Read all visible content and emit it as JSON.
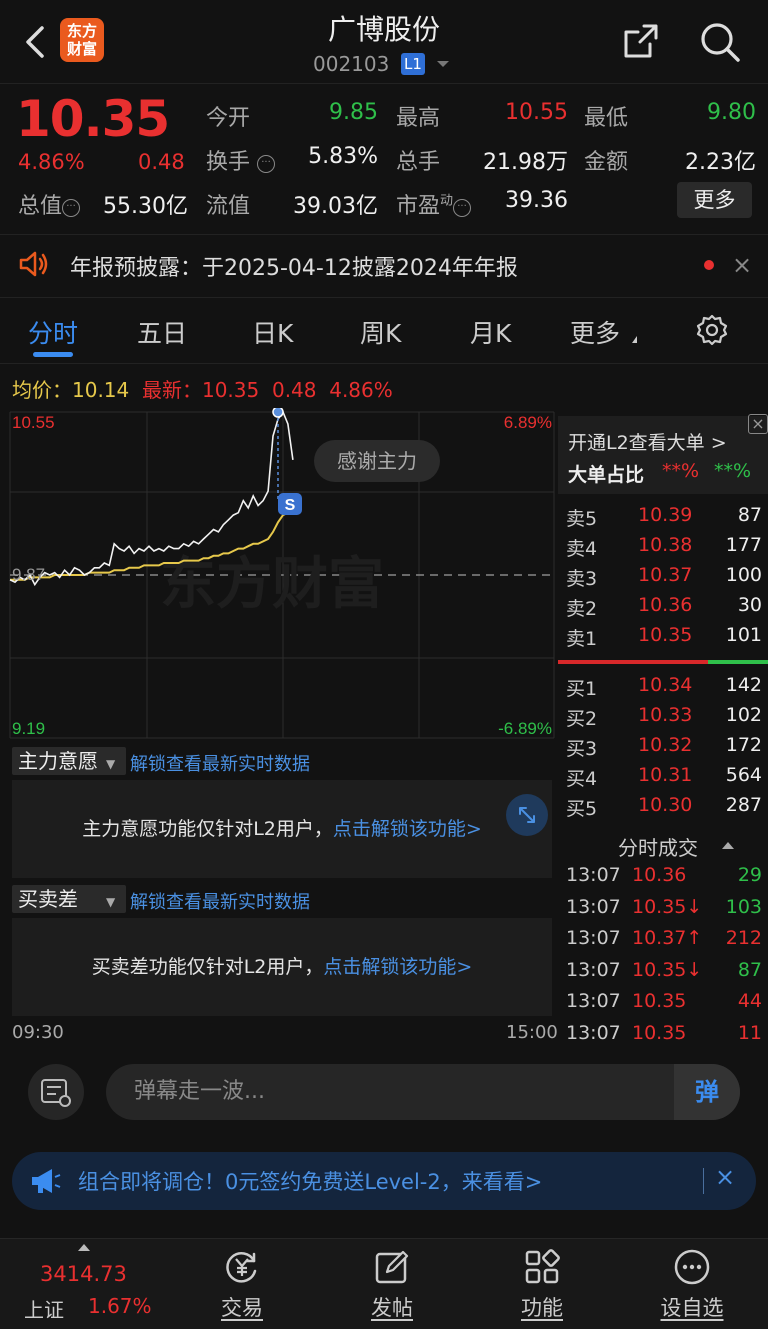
{
  "header": {
    "logo_line1": "东方",
    "logo_line2": "财富",
    "stock_name": "广博股份",
    "stock_code": "002103",
    "level_badge": "L1"
  },
  "quote": {
    "price": "10.35",
    "change_pct": "4.86%",
    "change": "0.48",
    "fields": {
      "open_label": "今开",
      "open": "9.85",
      "high_label": "最高",
      "high": "10.55",
      "low_label": "最低",
      "low": "9.80",
      "turnover_label": "换手",
      "turnover": "5.83%",
      "volume_label": "总手",
      "volume": "21.98万",
      "amount_label": "金额",
      "amount": "2.23亿",
      "mktcap_label": "总值",
      "mktcap": "55.30亿",
      "float_label": "流值",
      "float": "39.03亿",
      "pe_label": "市盈",
      "pe_sup": "动",
      "pe": "39.36"
    },
    "more_button": "更多"
  },
  "notice": {
    "text": "年报预披露：于2025-04-12披露2024年年报",
    "close": "×"
  },
  "tabs": [
    "分时",
    "五日",
    "日K",
    "周K",
    "月K",
    "更多"
  ],
  "avg_line": {
    "avg_label": "均价：",
    "avg_value": "10.14",
    "latest_label": "最新：",
    "latest_value": "10.35",
    "latest_change": "0.48",
    "latest_pct": "4.86%"
  },
  "chart_data": {
    "type": "line",
    "y_top_label": "10.55",
    "y_bottom_label": "9.19",
    "pct_top_label": "6.89%",
    "pct_bottom_label": "-6.89%",
    "prev_close_label": "9.87",
    "ylim": [
      9.19,
      10.55
    ],
    "prev_close": 9.87,
    "x_start_label": "09:30",
    "x_end_label": "15:00",
    "tooltip": "感谢主力",
    "signal_badge": "S",
    "series": [
      {
        "name": "价格",
        "values": [
          9.85,
          9.84,
          9.86,
          9.85,
          9.87,
          9.83,
          9.86,
          9.88,
          9.87,
          9.88,
          9.86,
          9.89,
          9.87,
          9.9,
          9.89,
          9.87,
          9.88,
          9.9,
          9.9,
          9.92,
          9.91,
          10.0,
          9.98,
          9.97,
          9.99,
          9.96,
          9.98,
          9.97,
          9.99,
          9.97,
          9.98,
          9.97,
          9.99,
          9.98,
          9.98,
          10.0,
          9.99,
          10.01,
          10.0,
          10.02,
          10.04,
          10.06,
          10.05,
          10.08,
          10.1,
          10.12,
          10.13,
          10.18,
          10.15,
          10.2,
          10.16,
          10.18,
          10.22,
          10.45,
          10.52,
          10.55,
          10.5,
          10.35
        ],
        "color": "#ffffff"
      },
      {
        "name": "均价",
        "values": [
          9.85,
          9.85,
          9.85,
          9.85,
          9.86,
          9.86,
          9.86,
          9.86,
          9.86,
          9.87,
          9.87,
          9.87,
          9.87,
          9.87,
          9.87,
          9.87,
          9.88,
          9.88,
          9.88,
          9.88,
          9.88,
          9.89,
          9.89,
          9.89,
          9.9,
          9.9,
          9.9,
          9.91,
          9.91,
          9.91,
          9.91,
          9.92,
          9.92,
          9.92,
          9.92,
          9.93,
          9.93,
          9.93,
          9.93,
          9.94,
          9.94,
          9.95,
          9.95,
          9.96,
          9.96,
          9.97,
          9.98,
          9.98,
          9.99,
          10.0,
          10.0,
          10.01,
          10.02,
          10.05,
          10.09,
          10.12,
          10.13,
          10.14
        ],
        "color": "#e6c84b"
      }
    ],
    "grid": true
  },
  "panels": {
    "main_intent_label": "主力意愿",
    "unlock_link": "解锁查看最新实时数据",
    "main_intent_text": "主力意愿功能仅针对L2用户，",
    "unlock_action": "点击解锁该功能>",
    "spread_label": "买卖差",
    "spread_text": "买卖差功能仅针对L2用户，"
  },
  "order_book": {
    "banner_text": "开通L2查看大单 >",
    "big_order_label": "大单占比",
    "big_order_red": "**%",
    "big_order_green": "**%",
    "asks": [
      {
        "label": "卖5",
        "price": "10.39",
        "vol": "87"
      },
      {
        "label": "卖4",
        "price": "10.38",
        "vol": "177"
      },
      {
        "label": "卖3",
        "price": "10.37",
        "vol": "100"
      },
      {
        "label": "卖2",
        "price": "10.36",
        "vol": "30"
      },
      {
        "label": "卖1",
        "price": "10.35",
        "vol": "101"
      }
    ],
    "bids": [
      {
        "label": "买1",
        "price": "10.34",
        "vol": "142"
      },
      {
        "label": "买2",
        "price": "10.33",
        "vol": "102"
      },
      {
        "label": "买3",
        "price": "10.32",
        "vol": "172"
      },
      {
        "label": "买4",
        "price": "10.31",
        "vol": "564"
      },
      {
        "label": "买5",
        "price": "10.30",
        "vol": "287"
      }
    ],
    "trades_title": "分时成交",
    "trades": [
      {
        "time": "13:07",
        "price": "10.36",
        "vol": "29",
        "vol_color": "green"
      },
      {
        "time": "13:07",
        "price": "10.35↓",
        "vol": "103",
        "vol_color": "green"
      },
      {
        "time": "13:07",
        "price": "10.37↑",
        "vol": "212",
        "vol_color": "red"
      },
      {
        "time": "13:07",
        "price": "10.35↓",
        "vol": "87",
        "vol_color": "green"
      },
      {
        "time": "13:07",
        "price": "10.35",
        "vol": "44",
        "vol_color": "red"
      },
      {
        "time": "13:07",
        "price": "10.35",
        "vol": "11",
        "vol_color": "red"
      }
    ]
  },
  "danmu": {
    "placeholder": "弹幕走一波...",
    "send_label": "弹"
  },
  "promo": {
    "text": "组合即将调仓！0元签约免费送Level-2，来看看>",
    "close": "×"
  },
  "bottom_nav": {
    "index_value": "3414.73",
    "index_name": "上证",
    "index_pct": "1.67%",
    "items": [
      "交易",
      "发帖",
      "功能",
      "设自选"
    ]
  },
  "colors": {
    "up": "#e93030",
    "down": "#2fbf4a",
    "accent": "#3b8cf0",
    "avg_line": "#e6c84b",
    "background": "#121212"
  }
}
